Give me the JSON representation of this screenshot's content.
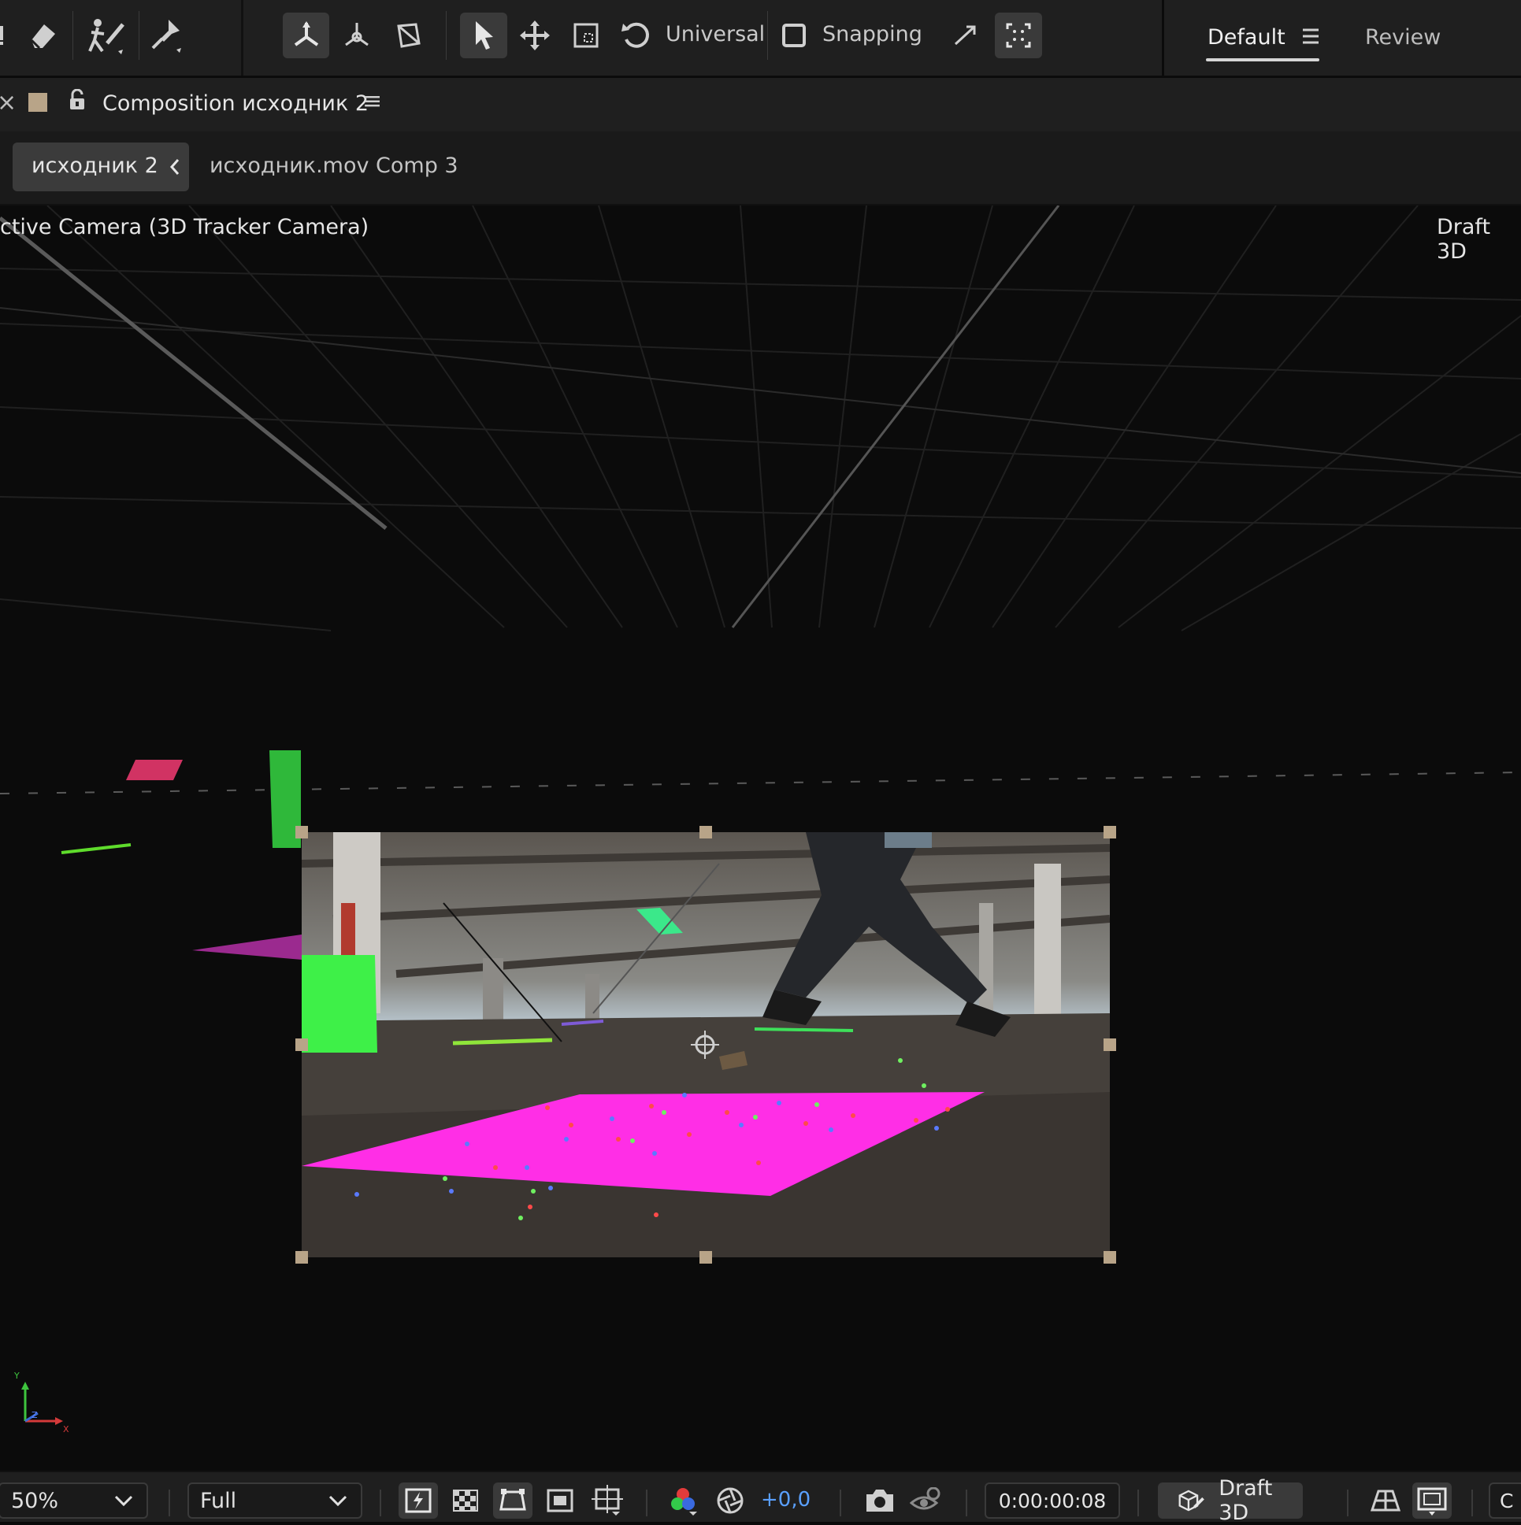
{
  "toolbar": {
    "axis_mode_label": "Universal",
    "snapping_label": "Snapping",
    "workspace_default": "Default",
    "workspace_review": "Review"
  },
  "panel": {
    "close_glyph": "×",
    "title": "Composition исходник 2",
    "menu_glyph": "≡"
  },
  "breadcrumb": {
    "active": "исходник 2",
    "next": "исходник.mov Comp 3"
  },
  "viewer": {
    "camera_label": "ctive Camera (3D Tracker Camera)",
    "renderer_label": "Draft 3D",
    "axis_y": "Y",
    "axis_z": "Z",
    "axis_x": "X"
  },
  "bottom": {
    "zoom": "50%",
    "resolution": "Full",
    "exposure": "+0,0",
    "timecode": "0:00:00:08",
    "draft3d_label": "Draft 3D",
    "cut_text": "C"
  },
  "colors": {
    "panel_bg": "#1f1f1f",
    "viewer_bg": "#0b0b0b",
    "track_plane_magenta": "#ff2ee6",
    "track_solid_green": "#3ef048",
    "accent_blue": "#5aa0ff"
  }
}
